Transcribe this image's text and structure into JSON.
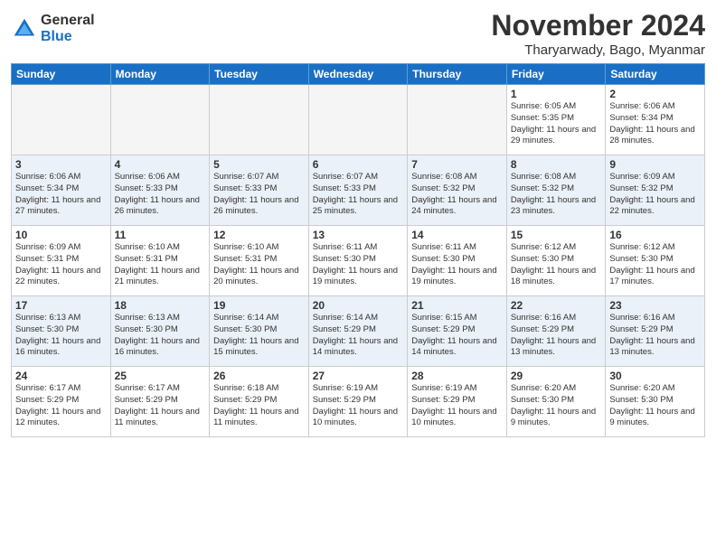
{
  "logo": {
    "general": "General",
    "blue": "Blue"
  },
  "title": "November 2024",
  "location": "Tharyarwady, Bago, Myanmar",
  "headers": [
    "Sunday",
    "Monday",
    "Tuesday",
    "Wednesday",
    "Thursday",
    "Friday",
    "Saturday"
  ],
  "weeks": [
    [
      {
        "day": "",
        "info": ""
      },
      {
        "day": "",
        "info": ""
      },
      {
        "day": "",
        "info": ""
      },
      {
        "day": "",
        "info": ""
      },
      {
        "day": "",
        "info": ""
      },
      {
        "day": "1",
        "info": "Sunrise: 6:05 AM\nSunset: 5:35 PM\nDaylight: 11 hours and 29 minutes."
      },
      {
        "day": "2",
        "info": "Sunrise: 6:06 AM\nSunset: 5:34 PM\nDaylight: 11 hours and 28 minutes."
      }
    ],
    [
      {
        "day": "3",
        "info": "Sunrise: 6:06 AM\nSunset: 5:34 PM\nDaylight: 11 hours and 27 minutes."
      },
      {
        "day": "4",
        "info": "Sunrise: 6:06 AM\nSunset: 5:33 PM\nDaylight: 11 hours and 26 minutes."
      },
      {
        "day": "5",
        "info": "Sunrise: 6:07 AM\nSunset: 5:33 PM\nDaylight: 11 hours and 26 minutes."
      },
      {
        "day": "6",
        "info": "Sunrise: 6:07 AM\nSunset: 5:33 PM\nDaylight: 11 hours and 25 minutes."
      },
      {
        "day": "7",
        "info": "Sunrise: 6:08 AM\nSunset: 5:32 PM\nDaylight: 11 hours and 24 minutes."
      },
      {
        "day": "8",
        "info": "Sunrise: 6:08 AM\nSunset: 5:32 PM\nDaylight: 11 hours and 23 minutes."
      },
      {
        "day": "9",
        "info": "Sunrise: 6:09 AM\nSunset: 5:32 PM\nDaylight: 11 hours and 22 minutes."
      }
    ],
    [
      {
        "day": "10",
        "info": "Sunrise: 6:09 AM\nSunset: 5:31 PM\nDaylight: 11 hours and 22 minutes."
      },
      {
        "day": "11",
        "info": "Sunrise: 6:10 AM\nSunset: 5:31 PM\nDaylight: 11 hours and 21 minutes."
      },
      {
        "day": "12",
        "info": "Sunrise: 6:10 AM\nSunset: 5:31 PM\nDaylight: 11 hours and 20 minutes."
      },
      {
        "day": "13",
        "info": "Sunrise: 6:11 AM\nSunset: 5:30 PM\nDaylight: 11 hours and 19 minutes."
      },
      {
        "day": "14",
        "info": "Sunrise: 6:11 AM\nSunset: 5:30 PM\nDaylight: 11 hours and 19 minutes."
      },
      {
        "day": "15",
        "info": "Sunrise: 6:12 AM\nSunset: 5:30 PM\nDaylight: 11 hours and 18 minutes."
      },
      {
        "day": "16",
        "info": "Sunrise: 6:12 AM\nSunset: 5:30 PM\nDaylight: 11 hours and 17 minutes."
      }
    ],
    [
      {
        "day": "17",
        "info": "Sunrise: 6:13 AM\nSunset: 5:30 PM\nDaylight: 11 hours and 16 minutes."
      },
      {
        "day": "18",
        "info": "Sunrise: 6:13 AM\nSunset: 5:30 PM\nDaylight: 11 hours and 16 minutes."
      },
      {
        "day": "19",
        "info": "Sunrise: 6:14 AM\nSunset: 5:30 PM\nDaylight: 11 hours and 15 minutes."
      },
      {
        "day": "20",
        "info": "Sunrise: 6:14 AM\nSunset: 5:29 PM\nDaylight: 11 hours and 14 minutes."
      },
      {
        "day": "21",
        "info": "Sunrise: 6:15 AM\nSunset: 5:29 PM\nDaylight: 11 hours and 14 minutes."
      },
      {
        "day": "22",
        "info": "Sunrise: 6:16 AM\nSunset: 5:29 PM\nDaylight: 11 hours and 13 minutes."
      },
      {
        "day": "23",
        "info": "Sunrise: 6:16 AM\nSunset: 5:29 PM\nDaylight: 11 hours and 13 minutes."
      }
    ],
    [
      {
        "day": "24",
        "info": "Sunrise: 6:17 AM\nSunset: 5:29 PM\nDaylight: 11 hours and 12 minutes."
      },
      {
        "day": "25",
        "info": "Sunrise: 6:17 AM\nSunset: 5:29 PM\nDaylight: 11 hours and 11 minutes."
      },
      {
        "day": "26",
        "info": "Sunrise: 6:18 AM\nSunset: 5:29 PM\nDaylight: 11 hours and 11 minutes."
      },
      {
        "day": "27",
        "info": "Sunrise: 6:19 AM\nSunset: 5:29 PM\nDaylight: 11 hours and 10 minutes."
      },
      {
        "day": "28",
        "info": "Sunrise: 6:19 AM\nSunset: 5:29 PM\nDaylight: 11 hours and 10 minutes."
      },
      {
        "day": "29",
        "info": "Sunrise: 6:20 AM\nSunset: 5:30 PM\nDaylight: 11 hours and 9 minutes."
      },
      {
        "day": "30",
        "info": "Sunrise: 6:20 AM\nSunset: 5:30 PM\nDaylight: 11 hours and 9 minutes."
      }
    ]
  ]
}
